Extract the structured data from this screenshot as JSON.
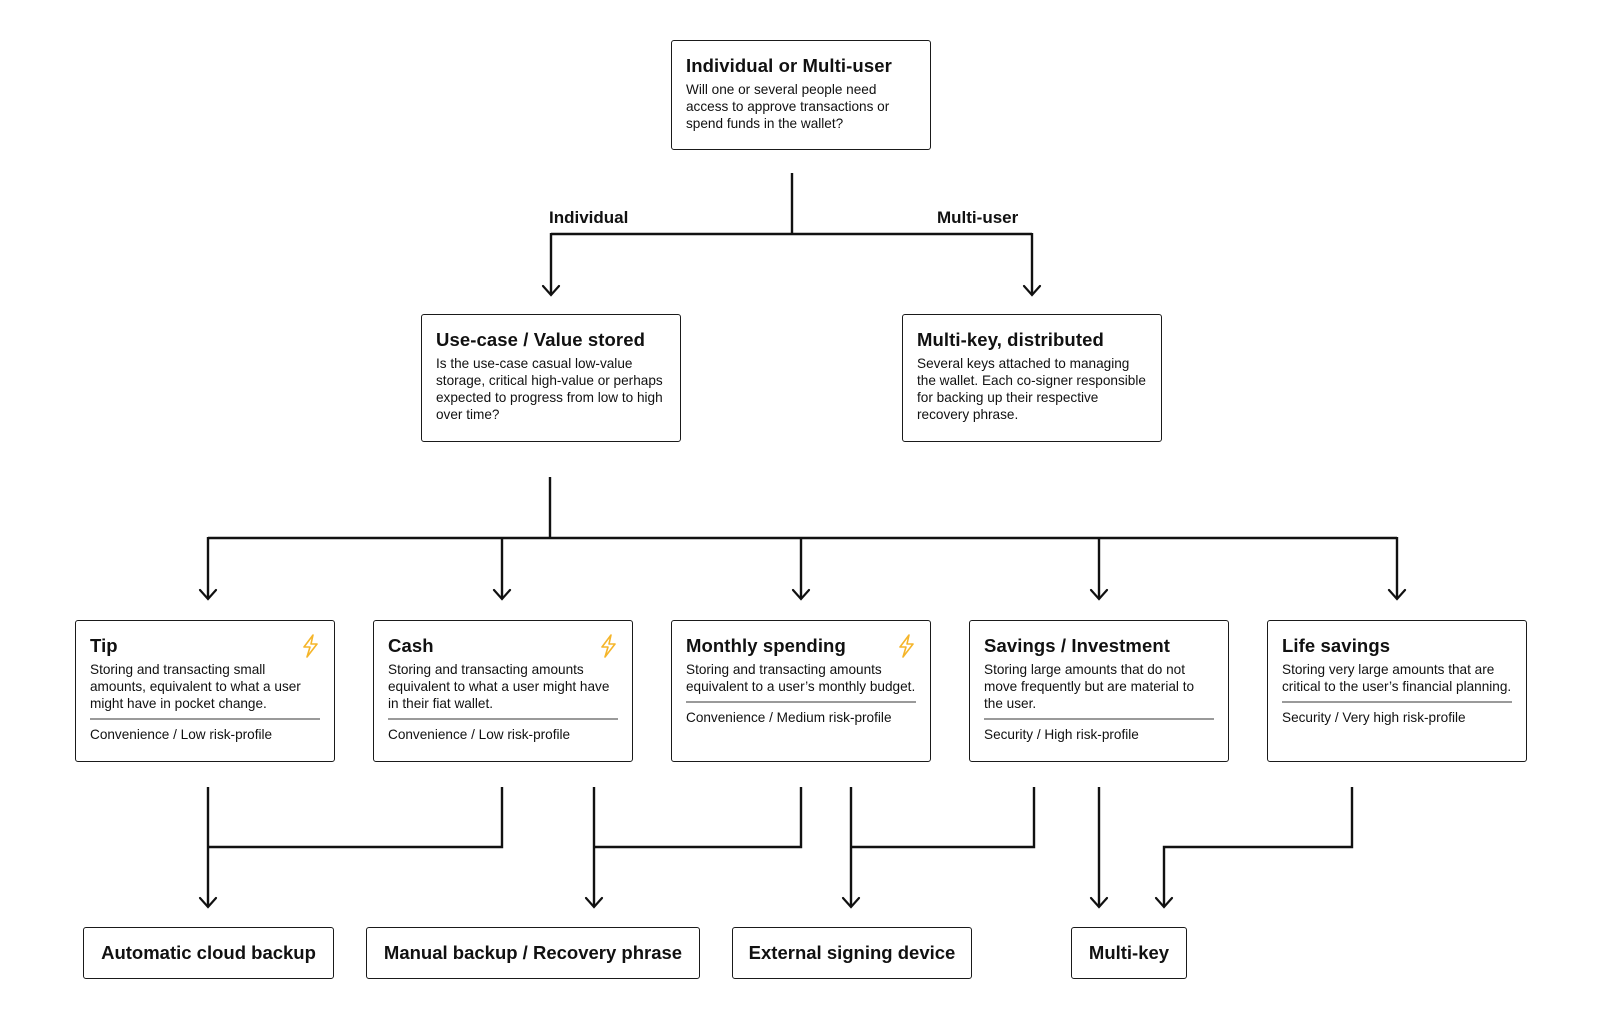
{
  "root": {
    "title": "Individual or Multi-user",
    "text": "Will one or several people need access to approve transactions or spend funds in the wallet?"
  },
  "branches": {
    "left_label": "Individual",
    "right_label": "Multi-user"
  },
  "individual": {
    "title": "Use-case / Value stored",
    "text": "Is the use-case casual low-value storage, critical high-value or perhaps expected to progress from low to high over time?"
  },
  "multi": {
    "title": "Multi-key, distributed",
    "text": "Several keys attached to managing the wallet. Each co-signer responsible for backing up their respective recovery phrase."
  },
  "use_cases": [
    {
      "title": "Tip",
      "text": "Storing and transacting small amounts, equivalent to what a user might have in pocket change.",
      "tag": "Convenience / Low risk-profile",
      "lightning": true
    },
    {
      "title": "Cash",
      "text": "Storing and transacting amounts equivalent to what a user might have in their fiat wallet.",
      "tag": "Convenience / Low risk-profile",
      "lightning": true
    },
    {
      "title": "Monthly spending",
      "text": "Storing and transacting amounts equivalent to a user’s monthly budget.",
      "tag": "Convenience / Medium risk-profile",
      "lightning": true
    },
    {
      "title": "Savings / Investment",
      "text": "Storing large amounts that do not move frequently but are material to the user.",
      "tag": "Security / High risk-profile",
      "lightning": false
    },
    {
      "title": "Life savings",
      "text": "Storing very large amounts that are critical to the user’s financial planning.",
      "tag": "Security / Very high risk-profile",
      "lightning": false
    }
  ],
  "outcomes": [
    {
      "label": "Automatic cloud backup"
    },
    {
      "label": "Manual backup / Recovery phrase"
    },
    {
      "label": "External signing device"
    },
    {
      "label": "Multi-key"
    }
  ],
  "colors": {
    "line": "#111111",
    "lightning": "#f5b52a",
    "divider": "#9a9a9a"
  }
}
